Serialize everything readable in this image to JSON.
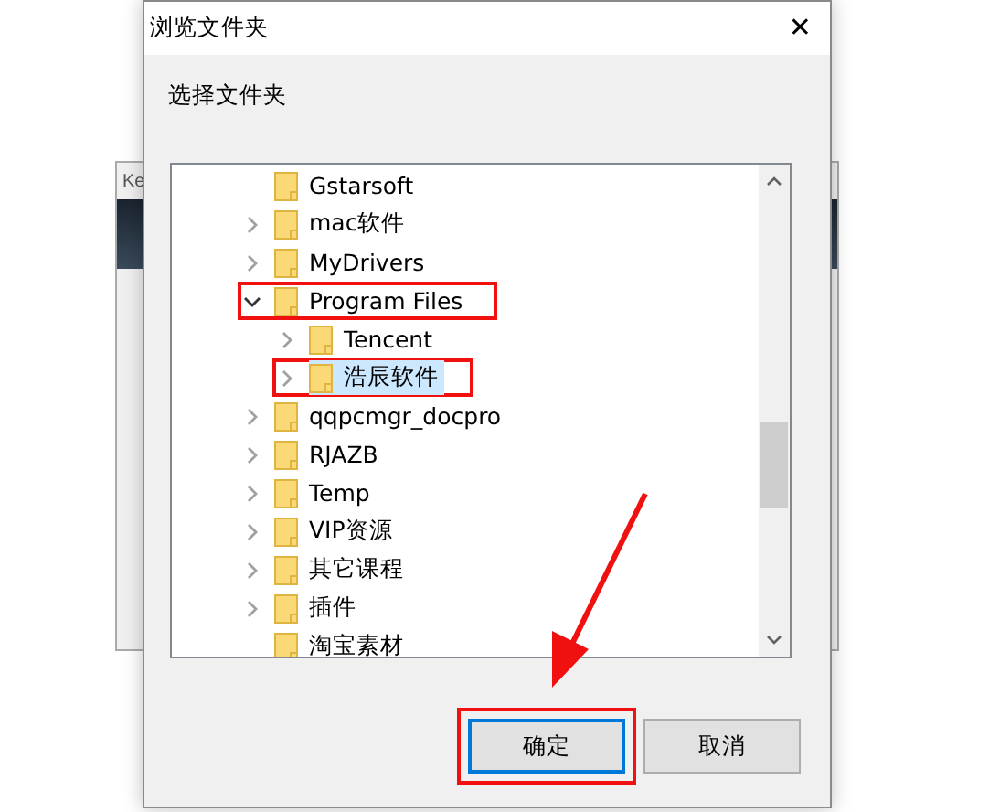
{
  "background_window": {
    "title": "Ke"
  },
  "dialog": {
    "title": "浏览文件夹",
    "close": "✕",
    "prompt": "选择文件夹"
  },
  "tree": [
    {
      "label": "Gstarsoft",
      "selected": false,
      "highlighted": false
    },
    {
      "label": "mac软件",
      "expanded": false,
      "selected": false,
      "highlighted": false
    },
    {
      "label": "MyDrivers",
      "expanded": false,
      "selected": false,
      "highlighted": false
    },
    {
      "label": "Program Files",
      "expanded": true,
      "selected": false,
      "highlighted": true,
      "children": [
        {
          "label": "Tencent",
          "expanded": false,
          "selected": false,
          "highlighted": false
        },
        {
          "label": "浩辰软件",
          "expanded": false,
          "selected": true,
          "highlighted": true
        }
      ]
    },
    {
      "label": "qqpcmgr_docpro",
      "expanded": false,
      "selected": false,
      "highlighted": false
    },
    {
      "label": "RJAZB",
      "expanded": false,
      "selected": false,
      "highlighted": false
    },
    {
      "label": "Temp",
      "expanded": false,
      "selected": false,
      "highlighted": false
    },
    {
      "label": "VIP资源",
      "expanded": false,
      "selected": false,
      "highlighted": false
    },
    {
      "label": "其它课程",
      "expanded": false,
      "selected": false,
      "highlighted": false
    },
    {
      "label": "插件",
      "expanded": false,
      "selected": false,
      "highlighted": false
    },
    {
      "label": "淘宝素材",
      "selected": false,
      "highlighted": false
    }
  ],
  "buttons": [
    {
      "label": "确定",
      "default": true,
      "highlighted": true
    },
    {
      "label": "取消",
      "default": false,
      "highlighted": false
    }
  ],
  "annotations": [
    {
      "kind": "arrow"
    }
  ]
}
